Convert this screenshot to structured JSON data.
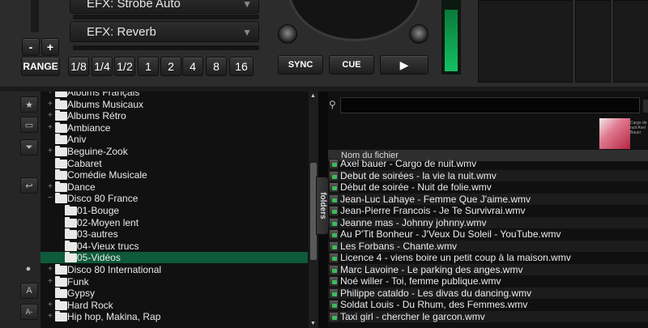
{
  "deck": {
    "efx_top": "EFX: Strobe Auto",
    "efx_bottom": "EFX: Reverb",
    "chevron": "▼",
    "minus": "-",
    "plus": "+",
    "range": "RANGE",
    "loop_sizes": [
      "1/8",
      "1/4",
      "1/2",
      "1",
      "2",
      "4",
      "8",
      "16"
    ],
    "sync": "SYNC",
    "cue": "CUE",
    "play": "▶",
    "vu_level": 0.9
  },
  "sidebar_tools": {
    "icons": [
      "star-icon",
      "window-icon",
      "filter-icon",
      "undo-icon",
      "dot-icon",
      "font-icon",
      "font-small-icon"
    ],
    "font_label": "A",
    "font_small_label": "A-"
  },
  "tree": {
    "items": [
      {
        "label": "Albums Français",
        "level": 0,
        "expandable": true
      },
      {
        "label": "Albums Musicaux",
        "level": 0,
        "expandable": true
      },
      {
        "label": "Albums Rétro",
        "level": 0,
        "expandable": true
      },
      {
        "label": "Ambiance",
        "level": 0,
        "expandable": true
      },
      {
        "label": "Aniv",
        "level": 0,
        "expandable": false
      },
      {
        "label": "Beguine-Zook",
        "level": 0,
        "expandable": true
      },
      {
        "label": "Cabaret",
        "level": 0,
        "expandable": false
      },
      {
        "label": "Comédie Musicale",
        "level": 0,
        "expandable": false
      },
      {
        "label": "Dance",
        "level": 0,
        "expandable": true
      },
      {
        "label": "Disco 80 France",
        "level": 0,
        "expandable": true,
        "expanded": true
      },
      {
        "label": "01-Bouge",
        "level": 1,
        "expandable": false
      },
      {
        "label": "02-Moyen lent",
        "level": 1,
        "expandable": false
      },
      {
        "label": "03-autres",
        "level": 1,
        "expandable": false
      },
      {
        "label": "04-Vieux trucs",
        "level": 1,
        "expandable": false
      },
      {
        "label": "05-Vidéos",
        "level": 1,
        "expandable": false,
        "selected": true
      },
      {
        "label": "Disco 80 International",
        "level": 0,
        "expandable": true
      },
      {
        "label": "Funk",
        "level": 0,
        "expandable": true
      },
      {
        "label": "Gypsy",
        "level": 0,
        "expandable": false
      },
      {
        "label": "Hard Rock",
        "level": 0,
        "expandable": true
      },
      {
        "label": "Hip hop, Makina, Rap",
        "level": 0,
        "expandable": true
      }
    ],
    "plus_glyph": "+",
    "minus_glyph": "−"
  },
  "folders_tab": "folders",
  "search": {
    "value": "",
    "placeholder": ""
  },
  "cover": {
    "text": "Cargo de nuit Axel Bauer"
  },
  "file_list": {
    "column_header": "Nom du fichier",
    "rows": [
      "Axel bauer - Cargo de nuit.wmv",
      "Debut de soirées - la vie la nuit.wmv",
      "Début de soirée - Nuit de folie.wmv",
      "Jean-Luc Lahaye - Femme Que J'aime.wmv",
      "Jean-Pierre Francois - Je Te Survivrai.wmv",
      "Jeanne mas - Johnny johnny.wmv",
      "Au P'Tit Bonheur - J'Veux Du Soleil - YouTube.wmv",
      "Les Forbans - Chante.wmv",
      "Licence 4 - viens boire un petit coup à la maison.wmv",
      "Marc Lavoine - Le parking des anges.wmv",
      "Noé willer - Toi, femme publique.wmv",
      "Philippe cataldo - Les divas du dancing.wmv",
      "Soldat Louis - Du Rhum, des Femmes.wmv",
      "Taxi girl - chercher le garcon.wmv"
    ]
  }
}
